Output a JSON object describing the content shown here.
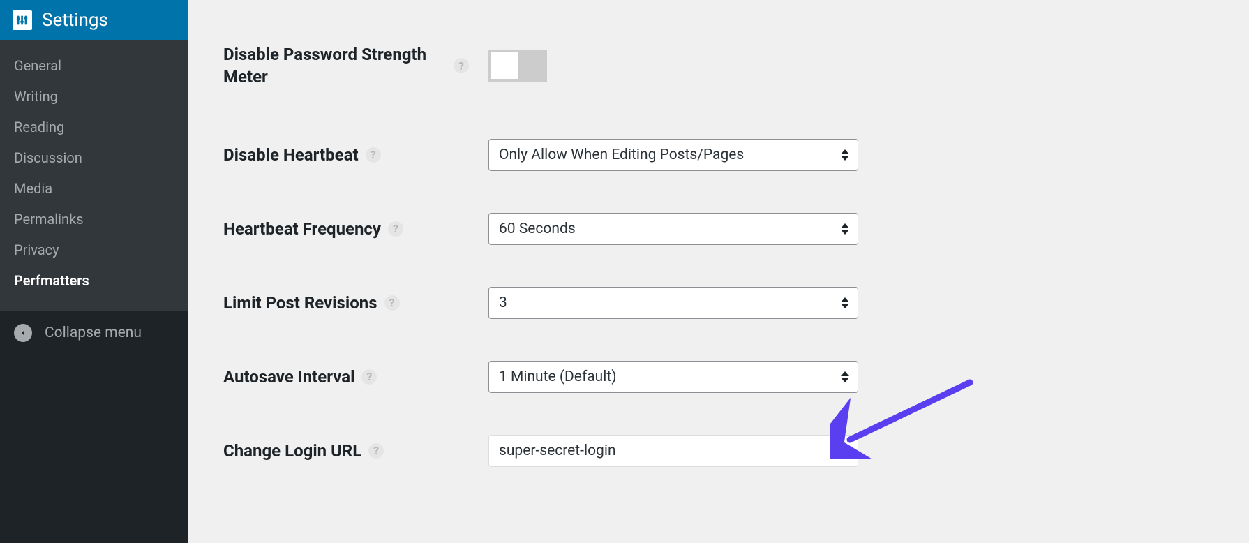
{
  "sidebar": {
    "header": {
      "title": "Settings",
      "icon": "sliders-icon"
    },
    "submenu": [
      {
        "label": "General",
        "active": false
      },
      {
        "label": "Writing",
        "active": false
      },
      {
        "label": "Reading",
        "active": false
      },
      {
        "label": "Discussion",
        "active": false
      },
      {
        "label": "Media",
        "active": false
      },
      {
        "label": "Permalinks",
        "active": false
      },
      {
        "label": "Privacy",
        "active": false
      },
      {
        "label": "Perfmatters",
        "active": true
      }
    ],
    "collapse_label": "Collapse menu"
  },
  "form": {
    "disable_password_strength": {
      "label": "Disable Password Strength Meter",
      "value": false
    },
    "disable_heartbeat": {
      "label": "Disable Heartbeat",
      "value": "Only Allow When Editing Posts/Pages"
    },
    "heartbeat_frequency": {
      "label": "Heartbeat Frequency",
      "value": "60 Seconds"
    },
    "limit_post_revisions": {
      "label": "Limit Post Revisions",
      "value": "3"
    },
    "autosave_interval": {
      "label": "Autosave Interval",
      "value": "1 Minute (Default)"
    },
    "change_login_url": {
      "label": "Change Login URL",
      "value": "super-secret-login"
    }
  },
  "annotation": {
    "arrow_color": "#5a3ff0"
  }
}
